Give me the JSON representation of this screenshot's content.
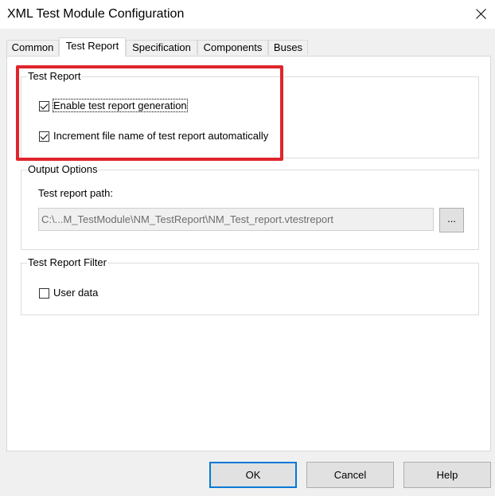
{
  "window": {
    "title": "XML Test Module Configuration"
  },
  "tabs": [
    {
      "label": "Common"
    },
    {
      "label": "Test Report"
    },
    {
      "label": "Specification"
    },
    {
      "label": "Components"
    },
    {
      "label": "Buses"
    }
  ],
  "test_report_group": {
    "label": "Test Report",
    "enable_generation": {
      "label": "Enable test report generation",
      "checked": true
    },
    "increment_filename": {
      "label": "Increment file name of test report automatically",
      "checked": true
    }
  },
  "output_options_group": {
    "label": "Output Options",
    "path_label": "Test report path:",
    "path_value": "C:\\...M_TestModule\\NM_TestReport\\NM_Test_report.vtestreport",
    "browse_label": "..."
  },
  "filter_group": {
    "label": "Test Report Filter",
    "user_data": {
      "label": "User data",
      "checked": false
    }
  },
  "buttons": {
    "ok": "OK",
    "cancel": "Cancel",
    "help": "Help"
  },
  "colors": {
    "highlight_box": "#e0252c",
    "default_button_border": "#0078d7"
  },
  "icons": {
    "close": "close-icon"
  }
}
